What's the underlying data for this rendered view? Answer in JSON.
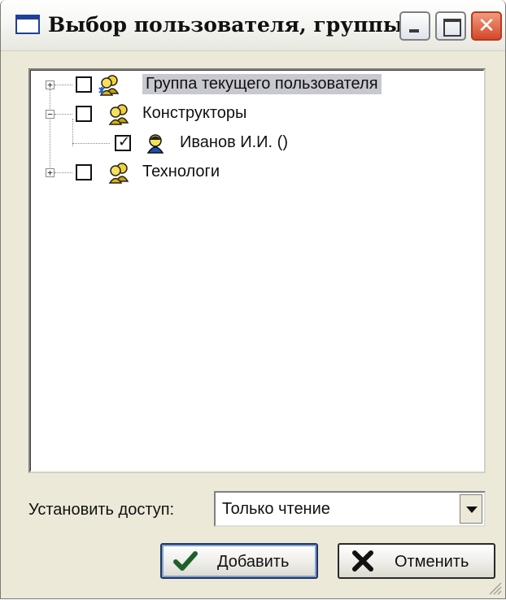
{
  "window": {
    "title": "Выбор пользователя, группы",
    "title_icon": "window-icon",
    "controls": {
      "minimize": "minimize-icon",
      "maximize": "maximize-icon",
      "close": "close-icon"
    }
  },
  "tree": {
    "nodes": [
      {
        "label": "Группа текущего пользователя",
        "checked": false,
        "expander": "+",
        "icon": "current-user-group-icon",
        "selected": true
      },
      {
        "label": "Конструкторы",
        "checked": false,
        "expander": "−",
        "icon": "user-group-icon",
        "selected": false
      },
      {
        "label": "Иванов И.И. ()",
        "checked": true,
        "expander": "",
        "icon": "user-icon",
        "selected": false
      },
      {
        "label": "Технологи",
        "checked": false,
        "expander": "+",
        "icon": "user-group-icon",
        "selected": false
      }
    ]
  },
  "access": {
    "label": "Установить доступ:",
    "value": "Только чтение"
  },
  "buttons": {
    "add": {
      "label": "Добавить",
      "icon": "checkmark-icon"
    },
    "cancel": {
      "label": "Отменить",
      "icon": "cross-icon"
    }
  },
  "colors": {
    "window_bg": "#ece9d8",
    "selection_bg": "#c8c8d0",
    "close_button": "#d4482c",
    "add_icon": "#1f5f2a",
    "cancel_icon": "#111111"
  }
}
